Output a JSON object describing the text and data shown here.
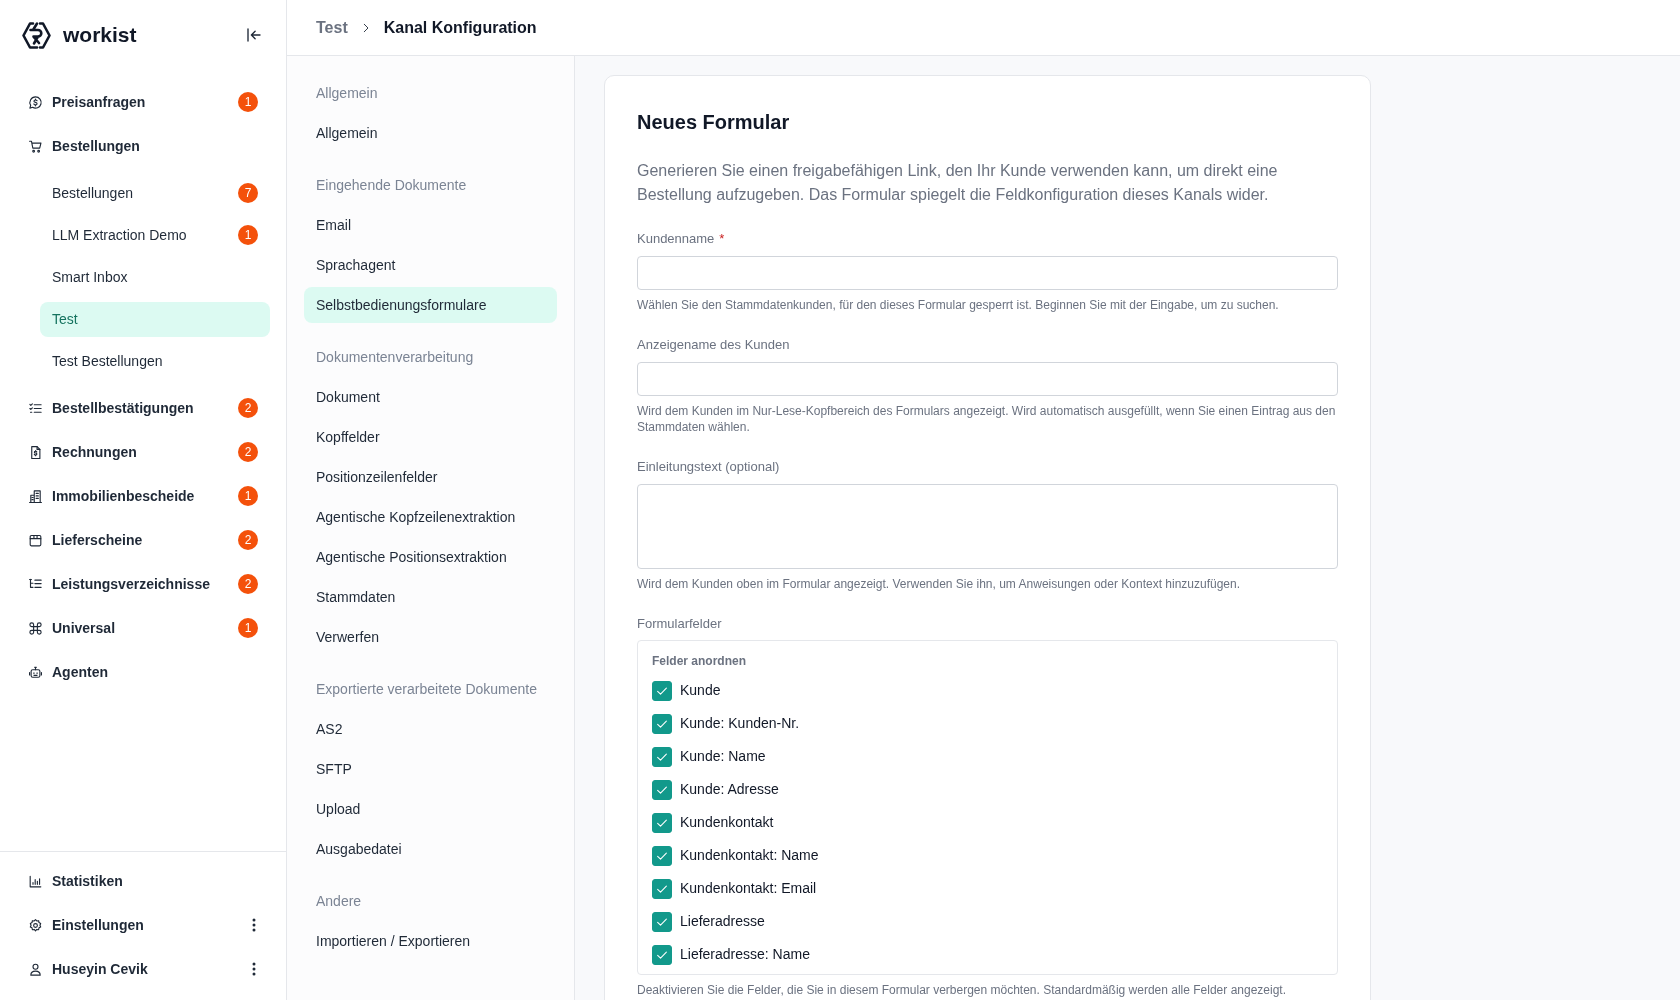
{
  "sidebar": {
    "logo_text": "workist",
    "nav": [
      {
        "label": "Preisanfragen",
        "badge": "1",
        "selected": false
      },
      {
        "label": "Bestellungen",
        "selected": false,
        "children": [
          {
            "label": "Bestellungen",
            "badge": "7",
            "selected": false
          },
          {
            "label": "LLM Extraction Demo",
            "badge": "1",
            "selected": false
          },
          {
            "label": "Smart Inbox",
            "selected": false
          },
          {
            "label": "Test",
            "selected": true
          },
          {
            "label": "Test Bestellungen",
            "selected": false
          }
        ]
      },
      {
        "label": "Bestellbestätigungen",
        "badge": "2",
        "selected": false
      },
      {
        "label": "Rechnungen",
        "badge": "2",
        "selected": false
      },
      {
        "label": "Immobilienbescheide",
        "badge": "1",
        "selected": false
      },
      {
        "label": "Lieferscheine",
        "badge": "2",
        "selected": false
      },
      {
        "label": "Leistungsverzeichnisse",
        "badge": "2",
        "selected": false
      },
      {
        "label": "Universal",
        "badge": "1",
        "selected": false
      },
      {
        "label": "Agenten",
        "selected": false
      }
    ],
    "footer": [
      {
        "label": "Statistiken",
        "menu": false,
        "selected": false
      },
      {
        "label": "Einstellungen",
        "menu": true,
        "selected": false
      },
      {
        "label": "Huseyin Cevik",
        "menu": true,
        "selected": false
      }
    ]
  },
  "breadcrumb": [
    "Test",
    "Kanal Konfiguration"
  ],
  "settings_nav": [
    {
      "title": "Allgemein",
      "items": [
        {
          "label": "Allgemein",
          "selected": false
        }
      ]
    },
    {
      "title": "Eingehende Dokumente",
      "items": [
        {
          "label": "Email",
          "selected": false
        },
        {
          "label": "Sprachagent",
          "selected": false
        },
        {
          "label": "Selbstbedienungsformulare",
          "selected": true
        }
      ]
    },
    {
      "title": "Dokumentenverarbeitung",
      "items": [
        {
          "label": "Dokument",
          "selected": false
        },
        {
          "label": "Kopffelder",
          "selected": false
        },
        {
          "label": "Positionzeilenfelder",
          "selected": false
        },
        {
          "label": "Agentische Kopfzeilenextraktion",
          "selected": false
        },
        {
          "label": "Agentische Positionsextraktion",
          "selected": false
        },
        {
          "label": "Stammdaten",
          "selected": false
        },
        {
          "label": "Verwerfen",
          "selected": false
        }
      ]
    },
    {
      "title": "Exportierte verarbeitete Dokumente",
      "items": [
        {
          "label": "AS2",
          "selected": false
        },
        {
          "label": "SFTP",
          "selected": false
        },
        {
          "label": "Upload",
          "selected": false
        },
        {
          "label": "Ausgabedatei",
          "selected": false
        }
      ]
    },
    {
      "title": "Andere",
      "items": [
        {
          "label": "Importieren / Exportieren",
          "selected": false
        }
      ]
    }
  ],
  "form": {
    "title": "Neues Formular",
    "description": "Generieren Sie einen freigabefähigen Link, den Ihr Kunde verwenden kann, um direkt eine Bestellung aufzugeben. Das Formular spiegelt die Feldkonfiguration dieses Kanals wider.",
    "fields": [
      {
        "kind": "input",
        "label": "Kundenname",
        "required_mark": "*",
        "help": "Wählen Sie den Stammdatenkunden, für den dieses Formular gesperrt ist. Beginnen Sie mit der Eingabe, um zu suchen."
      },
      {
        "kind": "input",
        "label": "Anzeigename des Kunden",
        "help": "Wird dem Kunden im Nur-Lese-Kopfbereich des Formulars angezeigt. Wird automatisch ausgefüllt, wenn Sie einen Eintrag aus den Stammdaten wählen."
      },
      {
        "kind": "textarea",
        "label": "Einleitungstext (optional)",
        "help": "Wird dem Kunden oben im Formular angezeigt. Verwenden Sie ihn, um Anweisungen oder Kontext hinzuzufügen."
      },
      {
        "kind": "checklist",
        "label": "Formularfelder",
        "heading": "Felder anordnen",
        "options": [
          {
            "label": "Kunde",
            "checked": true
          },
          {
            "label": "Kunde: Kunden-Nr.",
            "checked": true
          },
          {
            "label": "Kunde: Name",
            "checked": true
          },
          {
            "label": "Kunde: Adresse",
            "checked": true
          },
          {
            "label": "Kundenkontakt",
            "checked": true
          },
          {
            "label": "Kundenkontakt: Name",
            "checked": true
          },
          {
            "label": "Kundenkontakt: Email",
            "checked": true
          },
          {
            "label": "Lieferadresse",
            "checked": true
          },
          {
            "label": "Lieferadresse: Name",
            "checked": true
          }
        ],
        "help": "Deaktivieren Sie die Felder, die Sie in diesem Formular verbergen möchten. Standardmäßig werden alle Felder angezeigt."
      }
    ]
  }
}
